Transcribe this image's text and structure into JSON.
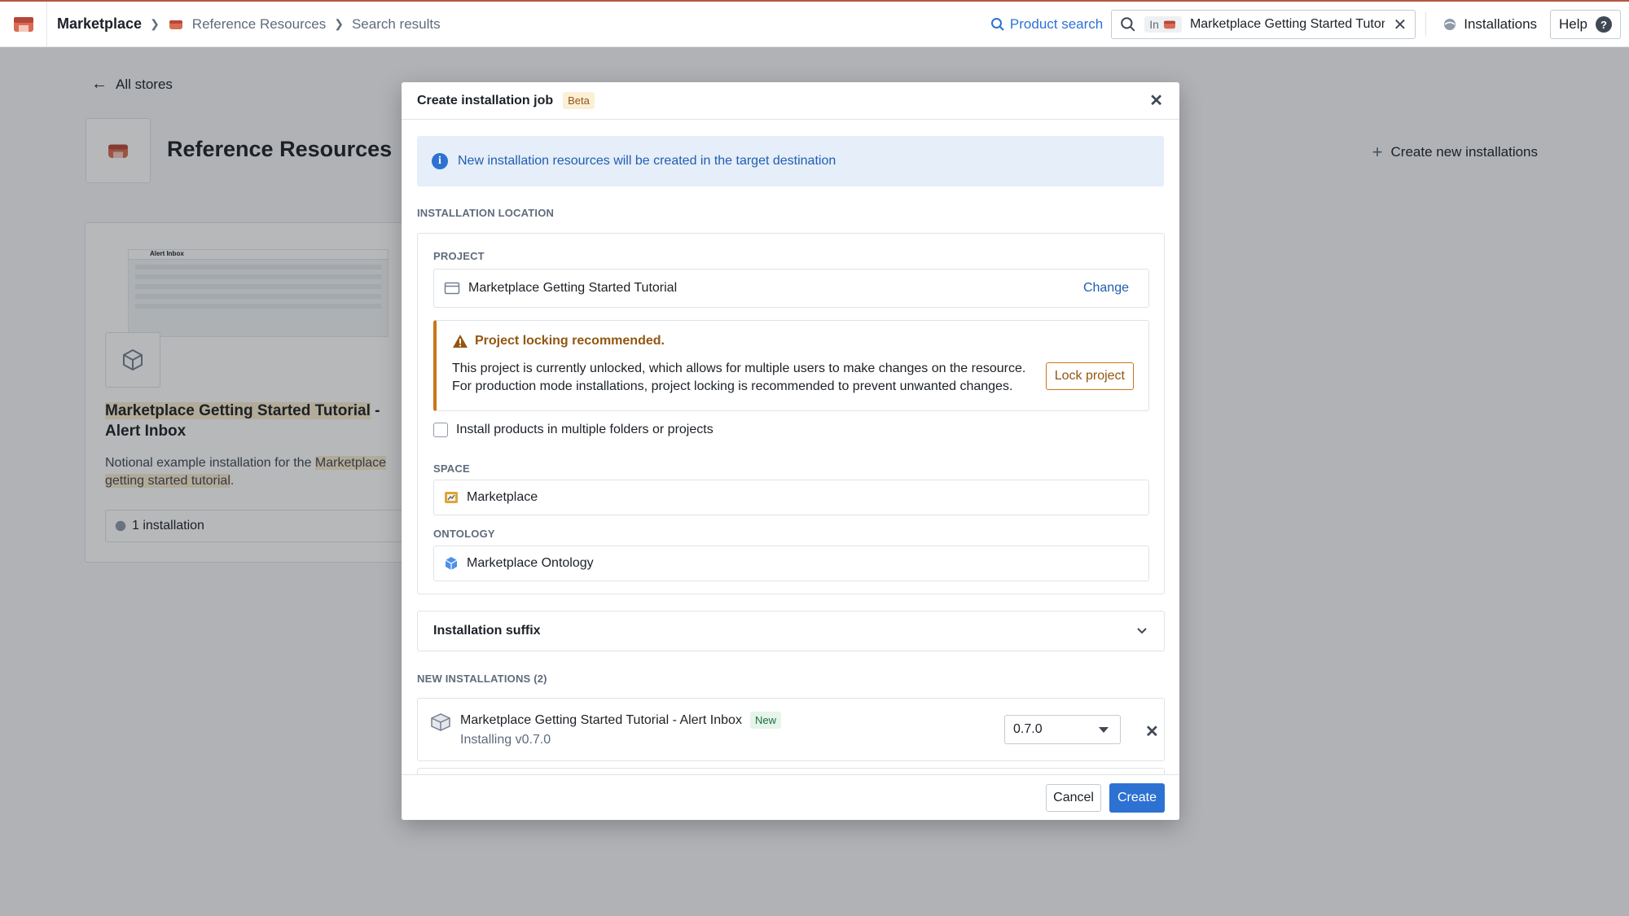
{
  "topbar": {
    "app_name": "Marketplace",
    "breadcrumbs": [
      "Reference Resources",
      "Search results"
    ],
    "product_search_label": "Product search",
    "scope_prefix": "In",
    "scope_text": "Marketplace Getting Started Tutori",
    "installations_label": "Installations",
    "help_label": "Help"
  },
  "page": {
    "back_label": "All stores",
    "store_title": "Reference Resources",
    "create_new_label": "Create new installations",
    "card": {
      "thumb_title": "Alert Inbox",
      "title_highlight": "Marketplace Getting Started Tutorial",
      "title_rest": " - Alert Inbox",
      "desc_part1": "Notional example installation for the ",
      "desc_highlight1": "Marketplace",
      "desc_part2": " ",
      "desc_highlight2": "getting started tutorial",
      "desc_part3": ".",
      "install_count": "1 installation"
    }
  },
  "modal": {
    "title": "Create installation job",
    "beta_tag": "Beta",
    "callout": "New installation resources will be created in the target destination",
    "location_label": "INSTALLATION LOCATION",
    "project_label": "PROJECT",
    "project_value": "Marketplace Getting Started Tutorial",
    "change_label": "Change",
    "warning_title": "Project locking recommended.",
    "warning_line1": "This project is currently unlocked, which allows for multiple users to make changes on the resource.",
    "warning_line2": "For production mode installations, project locking is recommended to prevent unwanted changes.",
    "lock_button": "Lock project",
    "multi_folder_label": "Install products in multiple folders or projects",
    "space_label": "SPACE",
    "space_value": "Marketplace",
    "ontology_label": "ONTOLOGY",
    "ontology_value": "Marketplace Ontology",
    "suffix_label": "Installation suffix",
    "new_installations_label": "NEW INSTALLATIONS (2)",
    "installation": {
      "name": "Marketplace Getting Started Tutorial - Alert Inbox",
      "tag": "New",
      "status": "Installing v0.7.0",
      "version": "0.7.0"
    },
    "cancel_label": "Cancel",
    "create_label": "Create"
  },
  "colors": {
    "accent": "#2d72d2",
    "warning": "#c87619",
    "brand": "#b5573f"
  }
}
